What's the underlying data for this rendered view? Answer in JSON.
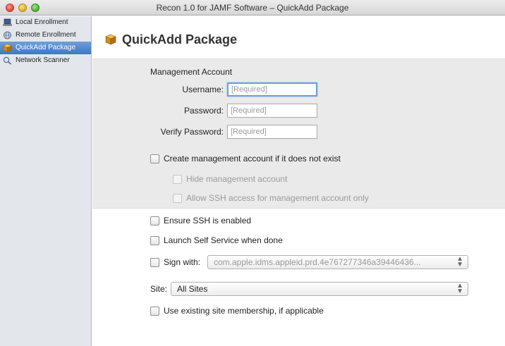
{
  "window": {
    "title": "Recon 1.0 for JAMF Software – QuickAdd Package"
  },
  "sidebar": {
    "items": [
      {
        "label": "Local Enrollment",
        "icon": "laptop-icon",
        "selected": false
      },
      {
        "label": "Remote Enrollment",
        "icon": "network-globe-icon",
        "selected": false
      },
      {
        "label": "QuickAdd Package",
        "icon": "package-icon",
        "selected": true
      },
      {
        "label": "Network Scanner",
        "icon": "magnifier-icon",
        "selected": false
      }
    ]
  },
  "main": {
    "heading": "QuickAdd Package",
    "management": {
      "section_title": "Management Account",
      "username_label": "Username:",
      "username_placeholder": "[Required]",
      "password_label": "Password:",
      "password_placeholder": "[Required]",
      "verify_label": "Verify Password:",
      "verify_placeholder": "[Required]",
      "create_account_label": "Create management account if it does not exist",
      "hide_account_label": "Hide management account",
      "allow_ssh_label": "Allow SSH access for management account only"
    },
    "options": {
      "ensure_ssh_label": "Ensure SSH is enabled",
      "launch_self_service_label": "Launch Self Service when done",
      "sign_with_label": "Sign with:",
      "sign_with_value": "com.apple.idms.appleid.prd.4e767277346a39446436...",
      "site_label": "Site:",
      "site_value": "All Sites",
      "use_site_membership_label": "Use existing site membership, if applicable"
    }
  },
  "colors": {
    "selection": "#3c78c4",
    "panel": "#eaeaea",
    "focus_ring": "#6c9ee0"
  }
}
